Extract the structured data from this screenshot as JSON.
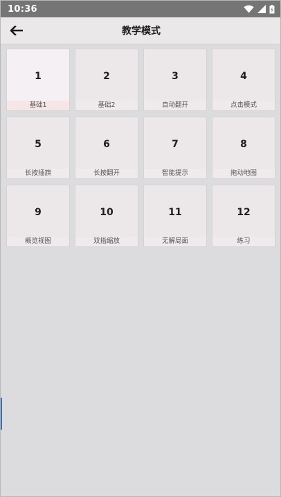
{
  "status_bar": {
    "time": "10:36",
    "icons": [
      "wifi-icon",
      "cellular-signal-icon",
      "battery-icon"
    ]
  },
  "app_bar": {
    "back_icon": "arrow-left-icon",
    "title": "教学模式"
  },
  "levels": [
    {
      "number": "1",
      "label": "基础1",
      "selected": true
    },
    {
      "number": "2",
      "label": "基础2"
    },
    {
      "number": "3",
      "label": "自动翻开"
    },
    {
      "number": "4",
      "label": "点击模式"
    },
    {
      "number": "5",
      "label": "长按插旗"
    },
    {
      "number": "6",
      "label": "长按翻开"
    },
    {
      "number": "7",
      "label": "智能提示"
    },
    {
      "number": "8",
      "label": "拖动地图"
    },
    {
      "number": "9",
      "label": "概览视图"
    },
    {
      "number": "10",
      "label": "双指缩放"
    },
    {
      "number": "11",
      "label": "无解局面"
    },
    {
      "number": "12",
      "label": "练习"
    }
  ],
  "colors": {
    "status_bar": "#757575",
    "app_bar": "#ebe8e9",
    "background": "#dcdcde",
    "card": "#ece8e9",
    "card_selected": "#f5f0f4"
  }
}
